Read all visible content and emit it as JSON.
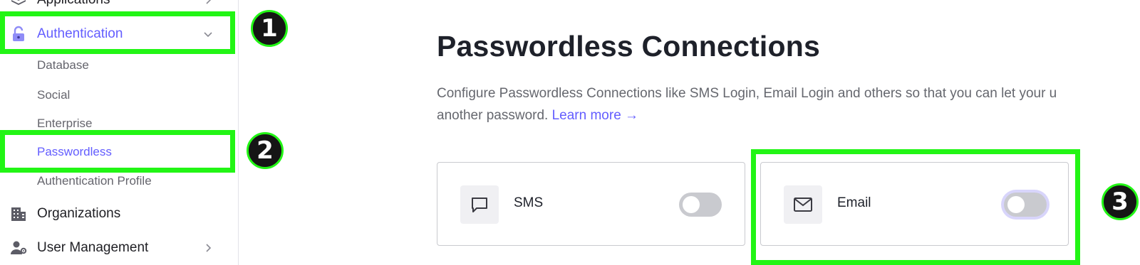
{
  "sidebar": {
    "items": [
      {
        "label": "Applications",
        "icon": "layers-icon"
      },
      {
        "label": "Authentication",
        "icon": "lock-open-icon",
        "active": true
      },
      {
        "label": "Organizations",
        "icon": "building-icon"
      },
      {
        "label": "User Management",
        "icon": "user-gear-icon"
      }
    ],
    "sub_items": [
      {
        "label": "Database"
      },
      {
        "label": "Social"
      },
      {
        "label": "Enterprise"
      },
      {
        "label": "Passwordless",
        "active": true
      },
      {
        "label": "Authentication Profile"
      }
    ]
  },
  "main": {
    "title": "Passwordless Connections",
    "description_line1": "Configure Passwordless Connections like SMS Login, Email Login and others so that you can let your u",
    "description_line2": "another password.",
    "learn_more": "Learn more →",
    "connections": [
      {
        "name": "SMS",
        "icon": "chat-bubble-icon",
        "enabled": false
      },
      {
        "name": "Email",
        "icon": "envelope-icon",
        "enabled": false
      }
    ]
  },
  "annotations": [
    "1",
    "2",
    "3"
  ],
  "colors": {
    "accent": "#635dff",
    "highlight": "#22f515",
    "badge_bg": "#151515",
    "toggle_off": "#c9cacf"
  }
}
